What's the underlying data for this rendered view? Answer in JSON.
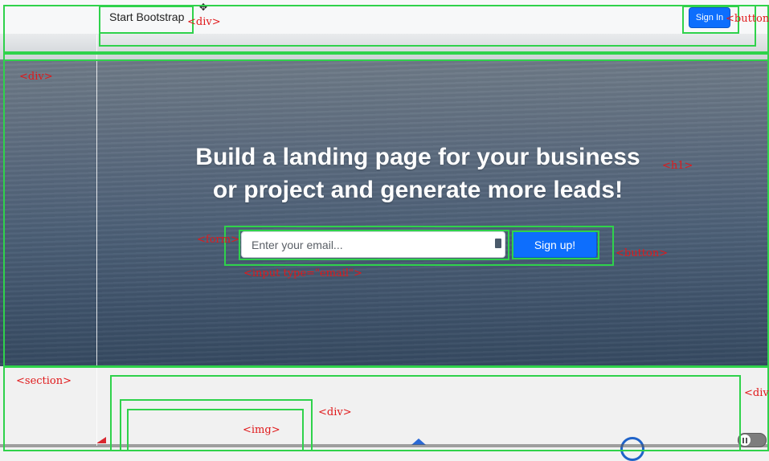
{
  "navbar": {
    "brand": "Start Bootstrap",
    "signin_label": "Sign In"
  },
  "hero": {
    "title_line1": "Build a landing page for your business",
    "title_line2": "or project and generate more leads!",
    "email_placeholder": "Enter your email...",
    "signup_label": "Sign up!"
  },
  "inspector_tags": {
    "navbar_div": "<div>",
    "navbar_button": "<button>",
    "hero_div": "<div>",
    "hero_h1": "<h1>",
    "form": "<form>",
    "input": "<input type=\"email\">",
    "signup_button": "<button>",
    "section": "<section>",
    "section_div_right": "<div",
    "inner_div": "<div>",
    "img": "<img>"
  },
  "colors": {
    "highlight_outline": "#2fd24b",
    "tag_text": "#e0191b",
    "primary_button": "#0d6efd"
  },
  "icons": [
    "cursor-icon",
    "pause-icon"
  ]
}
